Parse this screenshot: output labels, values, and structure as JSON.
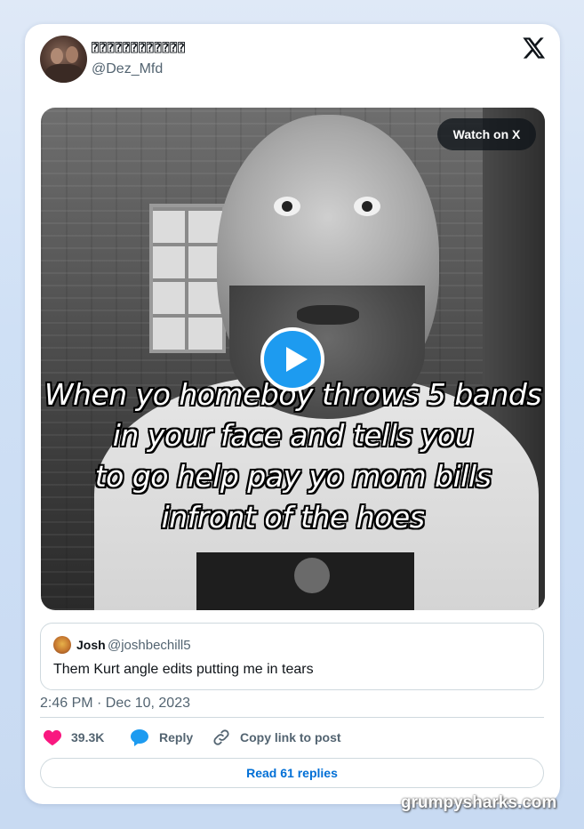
{
  "tweet": {
    "display_name": "⍰⍰⍰⍰⍰⍰⍰⍰⍰⍰⍰⍰",
    "handle": "@Dez_Mfd",
    "watch_on_x": "Watch on X",
    "caption_lines": [
      "When yo homeboy throws 5 bands",
      "in your face and tells you",
      "to go help pay yo mom bills",
      "infront of the hoes"
    ],
    "timestamp": "2:46 PM · Dec 10, 2023"
  },
  "quote": {
    "name": "Josh",
    "handle": "@joshbechill5",
    "text": "Them Kurt angle edits putting me in tears"
  },
  "actions": {
    "likes": "39.3K",
    "reply": "Reply",
    "copy_link": "Copy link to post"
  },
  "read_replies": "Read 61 replies",
  "watermark": "grumpysharks.com",
  "colors": {
    "like": "#f91880",
    "reply": "#1d9bf0",
    "play": "#1d9bf0",
    "link": "#006fd6"
  },
  "icons": [
    "x-logo-icon",
    "play-icon",
    "heart-icon",
    "reply-bubble-icon",
    "link-icon"
  ]
}
